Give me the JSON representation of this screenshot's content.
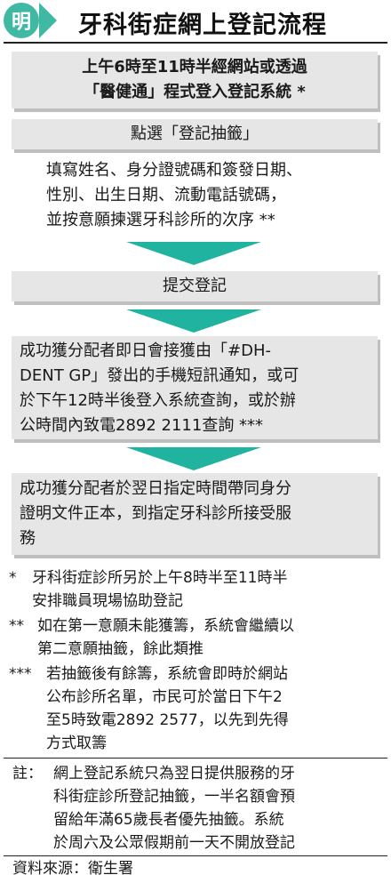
{
  "header": {
    "logo_char": "明",
    "title": "牙科街症網上登記流程"
  },
  "intro": {
    "line1": "上午6時至11時半經網站或透過",
    "line2": "「醫健通」程式登入登記系統 *"
  },
  "step_select": "點選「登記抽籤」",
  "step_fill": {
    "line1": "填寫姓名、身分證號碼和簽發日期、",
    "line2": "性別、出生日期、流動電話號碼，",
    "line3": "並按意願揀選牙科診所的次序 **"
  },
  "step_submit": "提交登記",
  "step_sms": {
    "line1": "成功獲分配者即日會接獲由「#DH-",
    "line2": "DENT GP」發出的手機短訊通知，或可",
    "line3": "於下午12時半後登入系統查詢，或於辦",
    "line4": "公時間內致電2892 2111查詢 ***"
  },
  "step_attend": {
    "line1": "成功獲分配者於翌日指定時間帶同身分",
    "line2": "證明文件正本，到指定牙科診所接受服",
    "line3": "務"
  },
  "notes": [
    {
      "mark": "*",
      "lines": [
        "牙科街症診所另於上午8時半至11時半",
        "安排職員現場協助登記"
      ]
    },
    {
      "mark": "**",
      "lines": [
        "如在第一意願未能獲籌，系統會繼續以",
        "第二意願抽籤，餘此類推"
      ]
    },
    {
      "mark": "***",
      "lines": [
        "若抽籤後有餘籌，系統會即時於網站",
        "公布診所名單，市民可於當日下午2",
        "至5時致電2892 2577，以先到先得",
        "方式取籌"
      ]
    }
  ],
  "remark": {
    "mark": "註：",
    "lines": [
      "網上登記系統只為翌日提供服務的牙",
      "科街症診所登記抽籤，一半名額會預",
      "留給年滿65歲長者優先抽籤。系統",
      "於周六及公眾假期前一天不開放登記"
    ]
  },
  "source": "資料來源：衛生署",
  "colors": {
    "accent": "#1fb3a0",
    "box": "#e6e6e6"
  }
}
